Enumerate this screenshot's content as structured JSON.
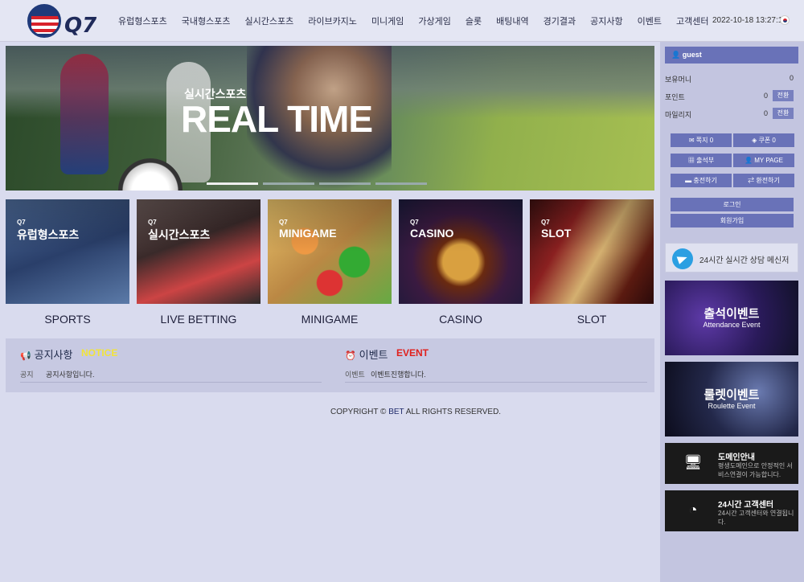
{
  "header": {
    "logo_text": "Q7",
    "nav": [
      "유럽형스포츠",
      "국내형스포츠",
      "실시간스포츠",
      "라이브카지노",
      "미니게임",
      "가상게임",
      "슬롯",
      "배팅내역",
      "경기결과",
      "공지사항",
      "이벤트",
      "고객센터"
    ],
    "datetime": "2022-10-18 13:27:16"
  },
  "hero": {
    "subtitle": "실시간스포츠",
    "title": "REAL TIME"
  },
  "games": [
    {
      "mark": "Q7",
      "label": "유럽형스포츠"
    },
    {
      "mark": "Q7",
      "label": "실시간스포츠"
    },
    {
      "mark": "Q7",
      "label": "MINIGAME"
    },
    {
      "mark": "Q7",
      "label": "CASINO"
    },
    {
      "mark": "Q7",
      "label": "SLOT"
    }
  ],
  "categories": [
    "SPORTS",
    "LIVE BETTING",
    "MINIGAME",
    "CASINO",
    "SLOT"
  ],
  "board": {
    "notice": {
      "title": "공지사항",
      "tag": "NOTICE",
      "tag_color": "#f2e43a",
      "row_key": "공지",
      "row_text": "공지사항입니다."
    },
    "event": {
      "title": "이벤트",
      "tag": "EVENT",
      "tag_color": "#e0201c",
      "row_key": "이벤트",
      "row_text": "이벤트진행합니다."
    }
  },
  "footer": {
    "prefix": "COPYRIGHT © ",
    "bet": "BET",
    "suffix": " ALL RIGHTS RESERVED."
  },
  "sidebar": {
    "user": "guest",
    "stats": [
      {
        "label": "보유머니",
        "value": "0"
      },
      {
        "label": "포인트",
        "value": "0",
        "action": "전환"
      },
      {
        "label": "마일리지",
        "value": "0",
        "action": "전환"
      }
    ],
    "buttons": [
      {
        "icon": "✉",
        "label": "쪽지 0"
      },
      {
        "icon": "◈",
        "label": "쿠폰 0"
      },
      {
        "icon": "▦",
        "label": "출석부"
      },
      {
        "icon": "👤",
        "label": "MY PAGE"
      },
      {
        "icon": "▬",
        "label": "충전하기"
      },
      {
        "icon": "⇄",
        "label": "환전하기"
      }
    ],
    "login": "로그인",
    "signup": "회원가입",
    "telegram": "24시간 실시간 상담 메신저",
    "banners": [
      {
        "title": "출석이벤트",
        "sub": "Attendance Event"
      },
      {
        "title": "룰렛이벤트",
        "sub": "Roulette Event"
      }
    ],
    "info": [
      {
        "title": "도메인안내",
        "desc": "평생도메인으로 안정적인 서비스연결이 가능합니다."
      },
      {
        "title": "24시간 고객센터",
        "desc": "24시간 고객센터와 연결됩니다."
      }
    ]
  }
}
